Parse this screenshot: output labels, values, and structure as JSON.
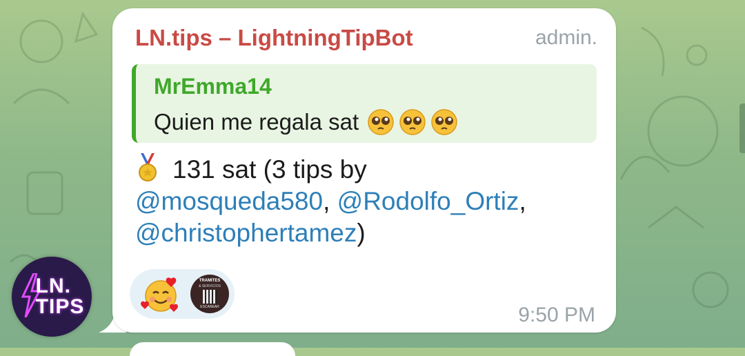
{
  "message": {
    "sender": "LN.tips – LightningTipBot",
    "admin_tag": "admin.",
    "reply": {
      "author": "MrEmma14",
      "text": "Quien me regala sat",
      "emoji": "pleading-face x3"
    },
    "body": {
      "amount_text": "131 sat (3 tips by",
      "mentions": [
        "@mosqueda580",
        "@Rodolfo_Ortiz",
        "@christophertamez"
      ],
      "sep1": ", ",
      "sep2": ",",
      "closing": ")"
    },
    "reaction_emoji": "smiling-face-with-hearts",
    "reactor_avatar_text": [
      "TRAMITES",
      "& SERVICIOS",
      "ESCANEAR"
    ],
    "time": "9:50 PM"
  },
  "avatar": {
    "line1": "LN.",
    "line2": "TIPS"
  },
  "colors": {
    "sender": "#c94a45",
    "reply_accent": "#3fa82b",
    "mention": "#2d7fb8",
    "reaction_bg": "#e6f1f7"
  }
}
